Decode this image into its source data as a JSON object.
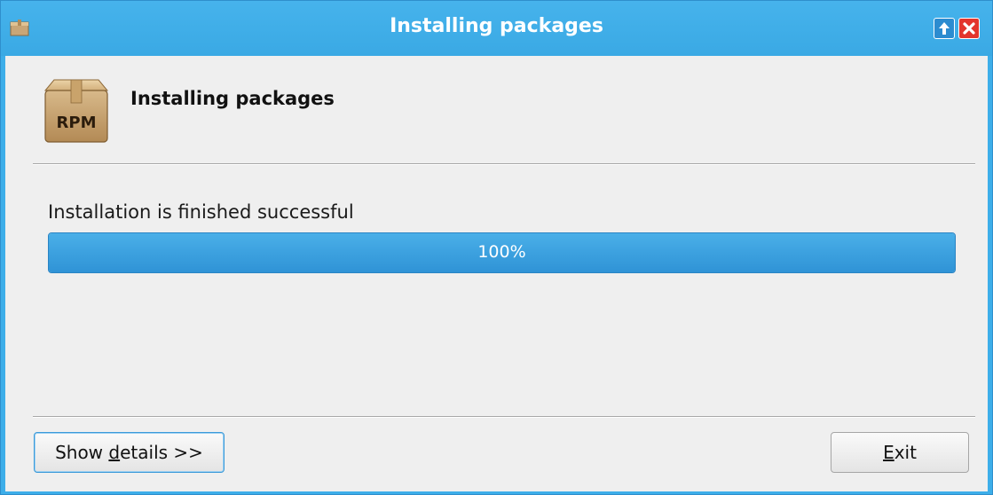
{
  "window": {
    "title": "Installing packages",
    "icons": {
      "app": "rpm-package-icon",
      "keep_above": "keep-above-icon",
      "close": "close-icon"
    },
    "colors": {
      "titlebar": "#3daee9",
      "close": "#e3352d"
    }
  },
  "header": {
    "icon": "rpm-package-icon",
    "icon_text": "RPM",
    "title": "Installing packages"
  },
  "status": {
    "message": "Installation is finished successful"
  },
  "progress": {
    "value": 100,
    "label": "100%"
  },
  "buttons": {
    "details": {
      "pre": "Show ",
      "mnemonic": "d",
      "post": "etails >>"
    },
    "exit": {
      "pre": "",
      "mnemonic": "E",
      "post": "xit"
    }
  }
}
